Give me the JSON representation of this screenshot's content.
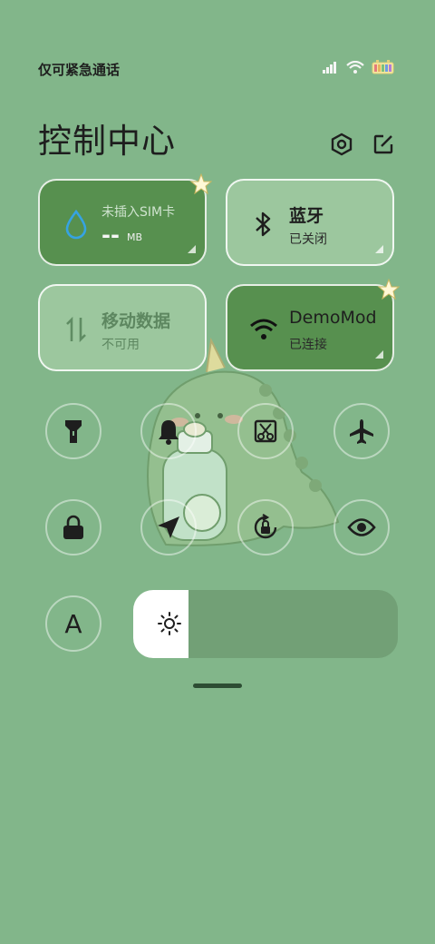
{
  "status_bar": {
    "carrier_text": "仅可紧急通话",
    "icons": [
      "signal-icon",
      "wifi-icon",
      "battery-icon"
    ]
  },
  "header": {
    "title": "控制中心",
    "icons": [
      "settings-icon",
      "edit-icon"
    ]
  },
  "tiles": [
    {
      "title": "未插入SIM卡",
      "value": "--",
      "unit": "MB",
      "icon": "water-drop-icon",
      "active": true
    },
    {
      "title": "蓝牙",
      "subtitle": "已关闭",
      "icon": "bluetooth-icon",
      "active": false
    },
    {
      "title": "移动数据",
      "subtitle": "不可用",
      "icon": "data-arrows-icon",
      "active": false
    },
    {
      "title": "DemoMod",
      "subtitle": "已连接",
      "icon": "wifi-icon",
      "active": true
    }
  ],
  "quick_toggles": [
    "flashlight-icon",
    "bell-icon",
    "screenshot-icon",
    "airplane-icon",
    "lock-icon",
    "location-icon",
    "rotation-lock-icon",
    "eye-icon"
  ],
  "font_toggle_label": "A",
  "brightness": {
    "level": 0.21,
    "icon": "sun-icon"
  },
  "colors": {
    "background": "#82b68a",
    "tile_active": "#57904f",
    "tile_inactive": "#9cc79e"
  }
}
